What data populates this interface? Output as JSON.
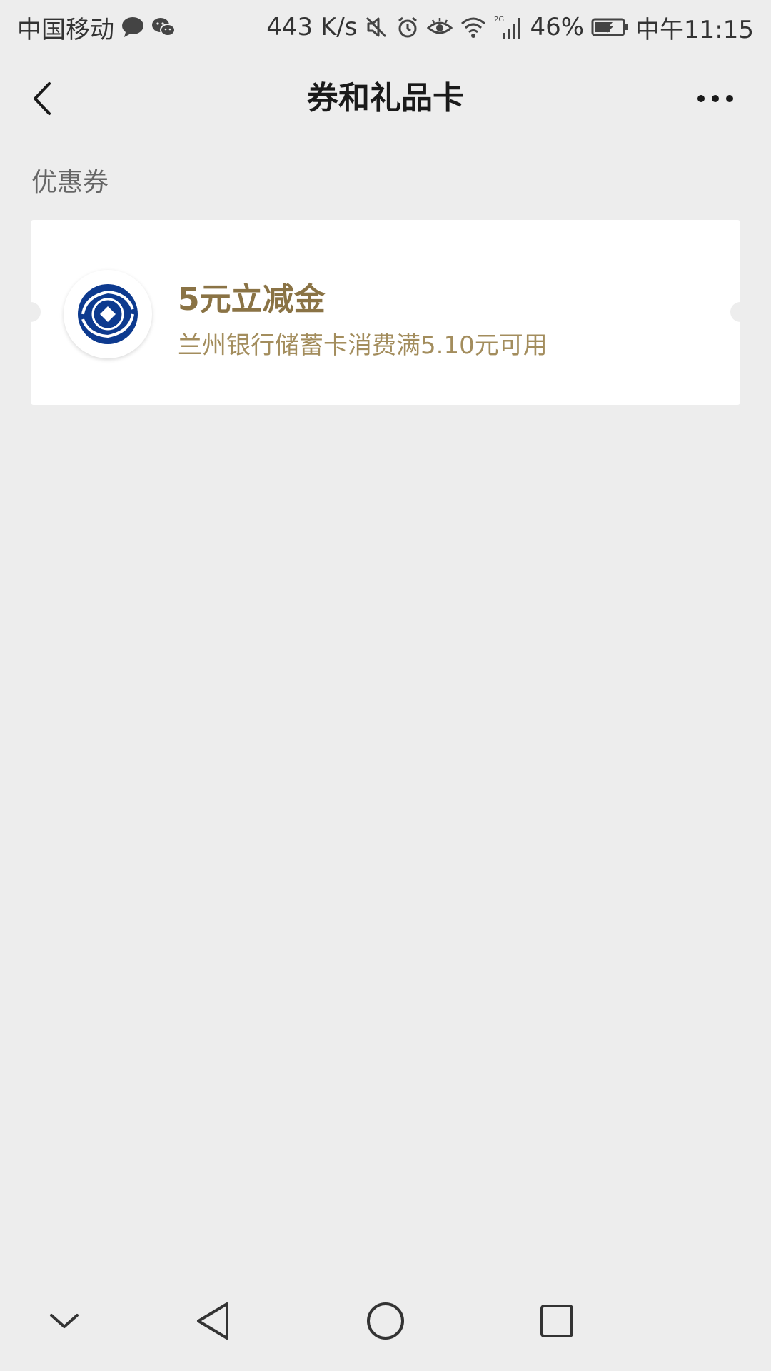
{
  "status_bar": {
    "carrier": "中国移动",
    "speed": "443 K/s",
    "signal_badge": "2G",
    "battery": "46%",
    "time": "中午11:15"
  },
  "nav": {
    "title": "券和礼品卡"
  },
  "section": {
    "label": "优惠券"
  },
  "coupon": {
    "title": "5元立减金",
    "description": "兰州银行储蓄卡消费满5.10元可用"
  },
  "colors": {
    "background": "#ededed",
    "coupon_title": "#8a7345",
    "coupon_desc": "#a38d5d",
    "bank_logo_blue": "#0d3a8f"
  },
  "icons": {
    "message": "chat-bubble-icon",
    "wechat": "wechat-icon",
    "mute": "mute-icon",
    "alarm": "alarm-icon",
    "eye": "eye-comfort-icon",
    "wifi": "wifi-icon",
    "signal": "signal-icon",
    "battery": "battery-charging-icon",
    "back": "back-arrow-icon",
    "more": "more-dots-icon",
    "logo": "bank-logo-icon",
    "sys_down": "collapse-down-icon",
    "sys_back": "system-back-icon",
    "sys_home": "system-home-icon",
    "sys_recent": "system-recent-apps-icon"
  }
}
